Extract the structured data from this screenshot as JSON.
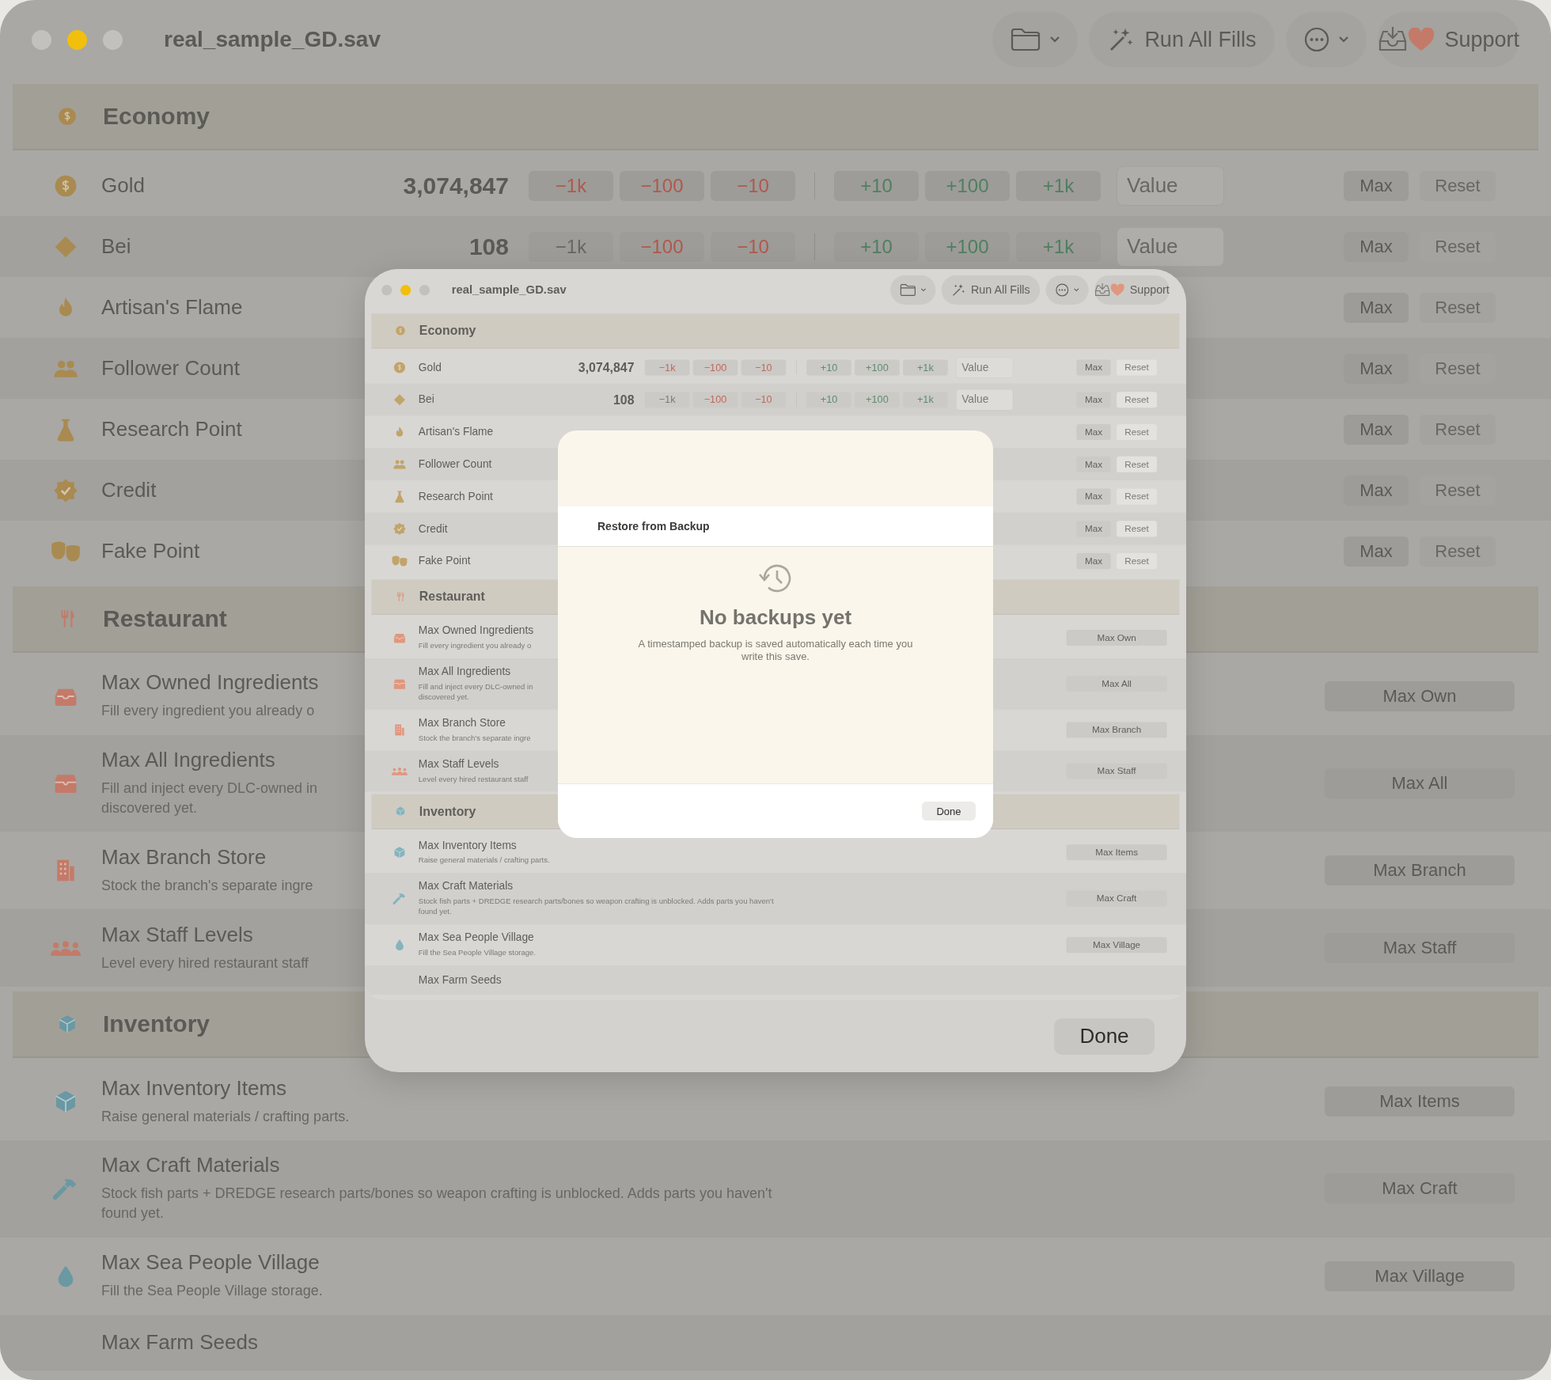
{
  "main_window": {
    "title": "real_sample_GD.sav",
    "traffic_lights": [
      {
        "active": false
      },
      {
        "active": true
      },
      {
        "active": false
      }
    ],
    "toolbar": {
      "run_all_fills": "Run All Fills",
      "support": "Support"
    },
    "sections": [
      {
        "title": "Economy",
        "rows": [
          {
            "kind": "counter",
            "name": "Gold",
            "value": "3,074,847",
            "minus": [
              {
                "label": "−1k",
                "disabled": false
              },
              {
                "label": "−100",
                "disabled": false
              },
              {
                "label": "−10",
                "disabled": false
              }
            ],
            "plus": [
              {
                "label": "+10",
                "disabled": false
              },
              {
                "label": "+100",
                "disabled": false
              },
              {
                "label": "+1k",
                "disabled": false
              }
            ],
            "placeholder": "Value",
            "max": "Max",
            "reset": {
              "label": "Reset",
              "disabled": true
            }
          },
          {
            "kind": "counter",
            "name": "Bei",
            "value": "108",
            "minus": [
              {
                "label": "−1k",
                "disabled": true
              },
              {
                "label": "−100",
                "disabled": false
              },
              {
                "label": "−10",
                "disabled": false
              }
            ],
            "plus": [
              {
                "label": "+10",
                "disabled": false
              },
              {
                "label": "+100",
                "disabled": false
              },
              {
                "label": "+1k",
                "disabled": false
              }
            ],
            "placeholder": "Value",
            "max": "Max",
            "reset": {
              "label": "Reset",
              "disabled": true
            }
          },
          {
            "kind": "counter",
            "name": "Artisan's Flame",
            "max": "Max",
            "reset": {
              "label": "Reset",
              "disabled": true
            }
          },
          {
            "kind": "counter",
            "name": "Follower Count",
            "max": "Max",
            "reset": {
              "label": "Reset",
              "disabled": true
            }
          },
          {
            "kind": "counter",
            "name": "Research Point",
            "max": "Max",
            "reset": {
              "label": "Reset",
              "disabled": true
            }
          },
          {
            "kind": "counter",
            "name": "Credit",
            "max": "Max",
            "reset": {
              "label": "Reset",
              "disabled": true
            }
          },
          {
            "kind": "counter",
            "name": "Fake Point",
            "max": "Max",
            "reset": {
              "label": "Reset",
              "disabled": true
            }
          }
        ]
      },
      {
        "title": "Restaurant",
        "rows": [
          {
            "kind": "action",
            "name": "Max Owned Ingredients",
            "desc": [
              "Fill every ingredient you already o"
            ],
            "button": "Max Own"
          },
          {
            "kind": "action",
            "name": "Max All Ingredients",
            "desc": [
              "Fill and inject every DLC-owned in",
              "discovered yet."
            ],
            "button": "Max All"
          },
          {
            "kind": "action",
            "name": "Max Branch Store",
            "desc": [
              "Stock the branch's separate ingre"
            ],
            "button": "Max Branch"
          },
          {
            "kind": "action",
            "name": "Max Staff Levels",
            "desc": [
              "Level every hired restaurant staff"
            ],
            "button": "Max Staff"
          }
        ]
      },
      {
        "title": "Inventory",
        "rows": [
          {
            "kind": "action",
            "name": "Max Inventory Items",
            "desc": [
              "Raise general materials / crafting parts."
            ],
            "button": "Max Items"
          },
          {
            "kind": "action",
            "name": "Max Craft Materials",
            "desc": [
              "Stock fish parts + DREDGE research parts/bones so weapon crafting is unblocked. Adds parts you haven't",
              "found yet."
            ],
            "button": "Max Craft"
          },
          {
            "kind": "action",
            "name": "Max Sea People Village",
            "desc": [
              "Fill the Sea People Village storage."
            ],
            "button": "Max Village"
          },
          {
            "kind": "action",
            "name": "Max Farm Seeds"
          }
        ]
      }
    ]
  },
  "backup_sheet": {
    "preview_window": {
      "title": "real_sample_GD.sav",
      "traffic_lights": [
        {
          "active": false
        },
        {
          "active": true
        },
        {
          "active": false
        }
      ],
      "toolbar": {
        "run_all_fills": "Run All Fills",
        "support": "Support"
      },
      "sections": [
        {
          "title": "Economy",
          "rows": [
            {
              "kind": "counter",
              "name": "Gold",
              "value": "3,074,847",
              "minus": [
                {
                  "label": "−1k",
                  "disabled": false
                },
                {
                  "label": "−100",
                  "disabled": false
                },
                {
                  "label": "−10",
                  "disabled": false
                }
              ],
              "plus": [
                {
                  "label": "+10",
                  "disabled": false
                },
                {
                  "label": "+100",
                  "disabled": false
                },
                {
                  "label": "+1k",
                  "disabled": false
                }
              ],
              "placeholder": "Value",
              "max": "Max",
              "reset": {
                "label": "Reset",
                "disabled": true
              }
            },
            {
              "kind": "counter",
              "name": "Bei",
              "value": "108",
              "minus": [
                {
                  "label": "−1k",
                  "disabled": true
                },
                {
                  "label": "−100",
                  "disabled": false
                },
                {
                  "label": "−10",
                  "disabled": false
                }
              ],
              "plus": [
                {
                  "label": "+10",
                  "disabled": false
                },
                {
                  "label": "+100",
                  "disabled": false
                },
                {
                  "label": "+1k",
                  "disabled": false
                }
              ],
              "placeholder": "Value",
              "max": "Max",
              "reset": {
                "label": "Reset",
                "disabled": true
              }
            },
            {
              "kind": "counter",
              "name": "Artisan's Flame",
              "max": "Max",
              "reset": {
                "label": "Reset",
                "disabled": true
              }
            },
            {
              "kind": "counter",
              "name": "Follower Count",
              "max": "Max",
              "reset": {
                "label": "Reset",
                "disabled": true
              }
            },
            {
              "kind": "counter",
              "name": "Research Point",
              "max": "Max",
              "reset": {
                "label": "Reset",
                "disabled": true
              }
            },
            {
              "kind": "counter",
              "name": "Credit",
              "max": "Max",
              "reset": {
                "label": "Reset",
                "disabled": true
              }
            },
            {
              "kind": "counter",
              "name": "Fake Point",
              "max": "Max",
              "reset": {
                "label": "Reset",
                "disabled": true
              }
            }
          ]
        },
        {
          "title": "Restaurant",
          "rows": [
            {
              "kind": "action",
              "name": "Max Owned Ingredients",
              "desc": [
                "Fill every ingredient you already o"
              ],
              "button": "Max Own"
            },
            {
              "kind": "action",
              "name": "Max All Ingredients",
              "desc": [
                "Fill and inject every DLC-owned in",
                "discovered yet."
              ],
              "button": "Max All"
            },
            {
              "kind": "action",
              "name": "Max Branch Store",
              "desc": [
                "Stock the branch's separate ingre"
              ],
              "button": "Max Branch"
            },
            {
              "kind": "action",
              "name": "Max Staff Levels",
              "desc": [
                "Level every hired restaurant staff"
              ],
              "button": "Max Staff"
            }
          ]
        },
        {
          "title": "Inventory",
          "rows": [
            {
              "kind": "action",
              "name": "Max Inventory Items",
              "desc": [
                "Raise general materials / crafting parts."
              ],
              "button": "Max Items"
            },
            {
              "kind": "action",
              "name": "Max Craft Materials",
              "desc": [
                "Stock fish parts + DREDGE research parts/bones so weapon crafting is unblocked. Adds parts you haven't",
                "found yet."
              ],
              "button": "Max Craft"
            },
            {
              "kind": "action",
              "name": "Max Sea People Village",
              "desc": [
                "Fill the Sea People Village storage."
              ],
              "button": "Max Village"
            },
            {
              "kind": "action",
              "name": "Max Farm Seeds"
            }
          ]
        }
      ]
    },
    "done": "Done",
    "dialog": {
      "title": "Restore from Backup",
      "empty_title": "No backups yet",
      "empty_text": "A timestamped backup is saved automatically each time you write this save.",
      "done": "Done"
    }
  }
}
